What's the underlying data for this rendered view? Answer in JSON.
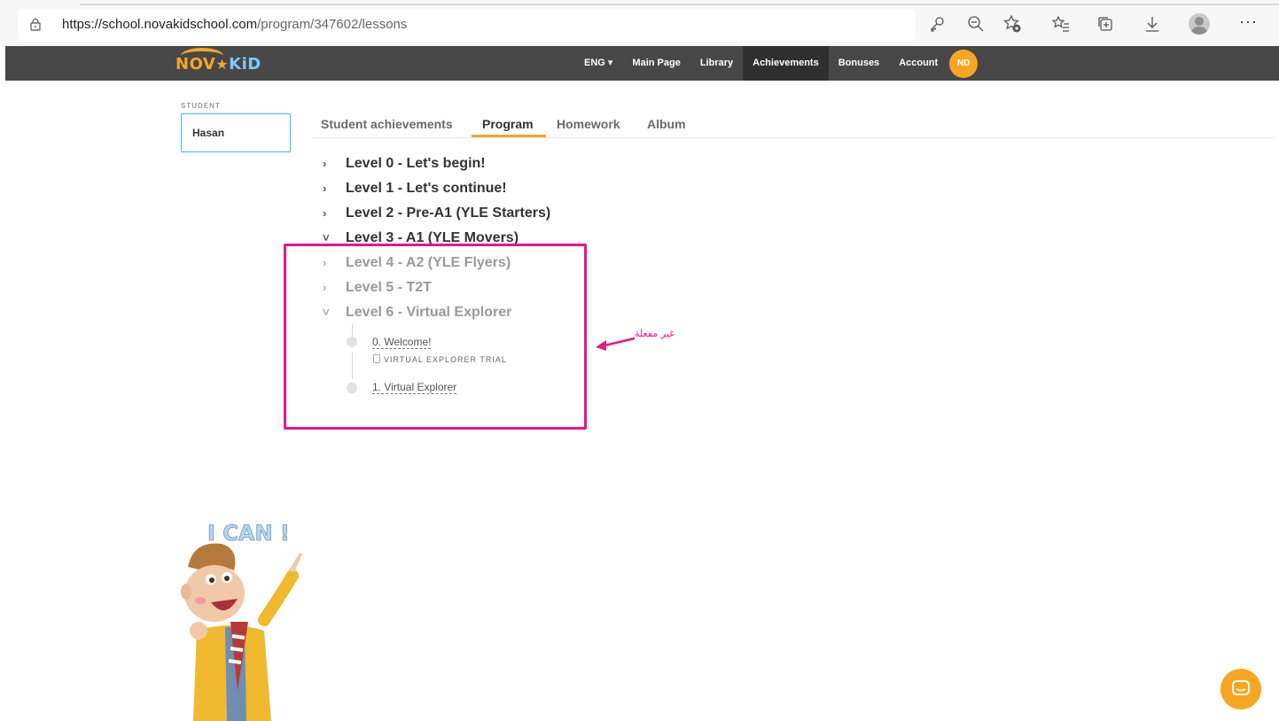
{
  "browser": {
    "url_host": "https://school.novakidschool.com",
    "url_path": "/program/347602/lessons",
    "toolbar_icons": [
      "key-icon",
      "zoom-out-icon",
      "add-favorite-icon",
      "favorites-icon",
      "collections-icon",
      "download-icon",
      "profile-icon",
      "more-icon"
    ],
    "more_label": "···"
  },
  "site": {
    "logo": {
      "nov": "NOV",
      "star": "★",
      "kid": "KiD"
    },
    "nav": {
      "language": "ENG ▾",
      "main_page": "Main Page",
      "library": "Library",
      "achievements": "Achievements",
      "bonuses": "Bonuses",
      "account": "Account",
      "avatar_initials": "ND"
    },
    "accent_color": "#f6a623",
    "navbar_color": "#474747"
  },
  "student": {
    "label": "STUDENT",
    "name": "Hasan"
  },
  "tabs": [
    {
      "label": "Student achievements",
      "active": false
    },
    {
      "label": "Program",
      "active": true
    },
    {
      "label": "Homework",
      "active": false
    },
    {
      "label": "Album",
      "active": false
    }
  ],
  "levels": [
    {
      "chevron": "›",
      "label": "Level 0 - Let's begin!",
      "expanded": false,
      "enabled": true
    },
    {
      "chevron": "›",
      "label": "Level 1 - Let's continue!",
      "expanded": false,
      "enabled": true
    },
    {
      "chevron": "›",
      "label": "Level 2 - Pre-A1 (YLE Starters)",
      "expanded": false,
      "enabled": true
    },
    {
      "chevron": "˅",
      "label": "Level 3 - A1 (YLE Movers)",
      "expanded": true,
      "enabled": true
    },
    {
      "chevron": "›",
      "label": "Level 4 - A2 (YLE Flyers)",
      "expanded": false,
      "enabled": false
    },
    {
      "chevron": "›",
      "label": "Level 5 - T2T",
      "expanded": false,
      "enabled": false
    },
    {
      "chevron": "˅",
      "label": "Level 6 - Virtual Explorer",
      "expanded": true,
      "enabled": false
    }
  ],
  "lessons": [
    {
      "label": "0. Welcome!",
      "tag": "VIRTUAL EXPLORER TRIAL"
    },
    {
      "label": "1. Virtual Explorer",
      "tag": ""
    }
  ],
  "annotation": {
    "text": "غير مفعلة",
    "color": "#e6197f"
  },
  "illustration": {
    "caption": "I CAN !"
  }
}
